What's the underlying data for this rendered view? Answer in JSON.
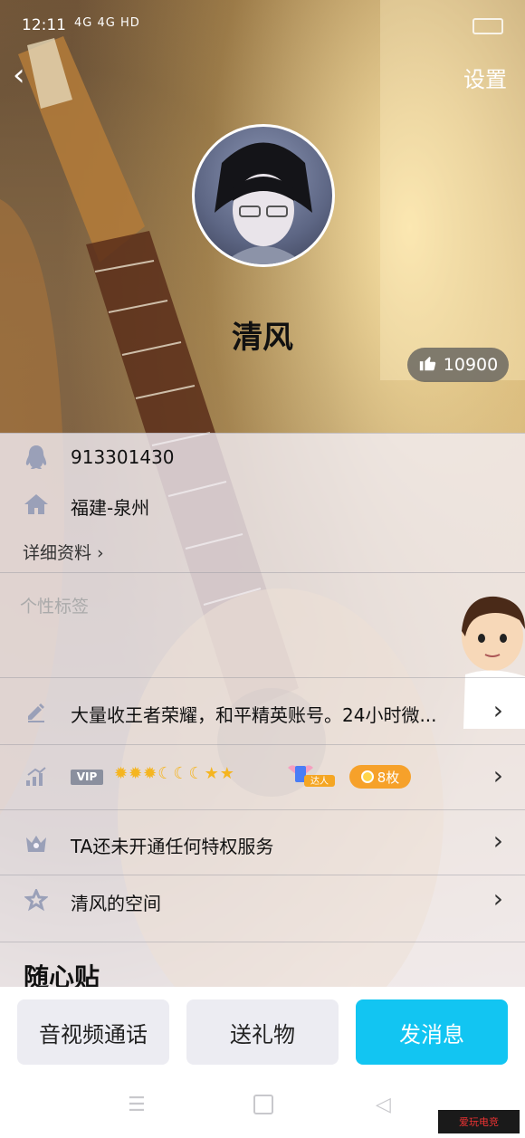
{
  "status": {
    "time": "12:11",
    "signal": "4G 4G HD"
  },
  "header": {
    "back_label": "‹",
    "settings_label": "设置"
  },
  "profile": {
    "nickname": "清风",
    "likes": "10900"
  },
  "info": {
    "qq_number": "913301430",
    "location": "福建-泉州",
    "details_link": "详细资料 ›",
    "tags_placeholder": "个性标签"
  },
  "rows": {
    "signature": "大量收王者荣耀，和平精英账号。24小时微...",
    "vip_badge": "VIP",
    "level_icons": "✹✹✹☾☾☾★★",
    "daren_badge": "达人",
    "coins": "8枚",
    "privilege": "TA还未开通任何特权服务",
    "space": "清风的空间"
  },
  "section": {
    "title": "随心贴"
  },
  "actions": {
    "call": "音视频通话",
    "gift": "送礼物",
    "message": "发消息"
  },
  "watermark": "爱玩电竞",
  "icons": [
    "back-icon",
    "thumbs-up-icon",
    "qq-penguin-icon",
    "home-icon",
    "pencil-icon",
    "chart-icon",
    "crown-icon",
    "star-icon",
    "chevron-right-icon"
  ],
  "colors": {
    "accent": "#12c5f2",
    "coin": "#f6a12a"
  }
}
